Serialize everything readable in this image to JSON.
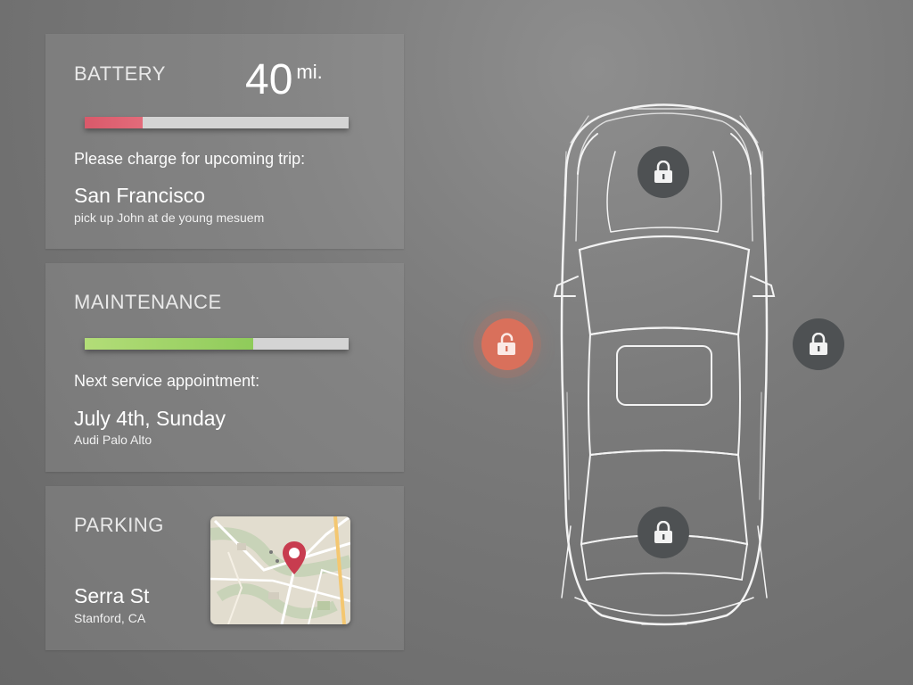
{
  "battery": {
    "title": "BATTERY",
    "range_value": "40",
    "range_unit": "mi.",
    "level": 0.22,
    "bar_color": "#d9596a",
    "prompt": "Please charge for upcoming trip:",
    "destination": "San Francisco",
    "note": "pick up John at de young mesuem"
  },
  "maintenance": {
    "title": "MAINTENANCE",
    "level": 0.64,
    "bar_color": "#8fcb5a",
    "prompt": "Next service appointment:",
    "date": "July 4th, Sunday",
    "location": "Audi Palo Alto"
  },
  "parking": {
    "title": "PARKING",
    "street": "Serra St",
    "city": "Stanford, CA",
    "map_icon": "map-pin-icon"
  },
  "car": {
    "locks": [
      {
        "name": "front",
        "state": "locked",
        "icon": "lock-icon"
      },
      {
        "name": "left",
        "state": "unlocked",
        "icon": "unlock-icon"
      },
      {
        "name": "right",
        "state": "locked",
        "icon": "lock-icon"
      },
      {
        "name": "rear",
        "state": "locked",
        "icon": "lock-icon"
      }
    ],
    "unlocked_color": "#d9705b",
    "locked_color": "#4e5153"
  }
}
